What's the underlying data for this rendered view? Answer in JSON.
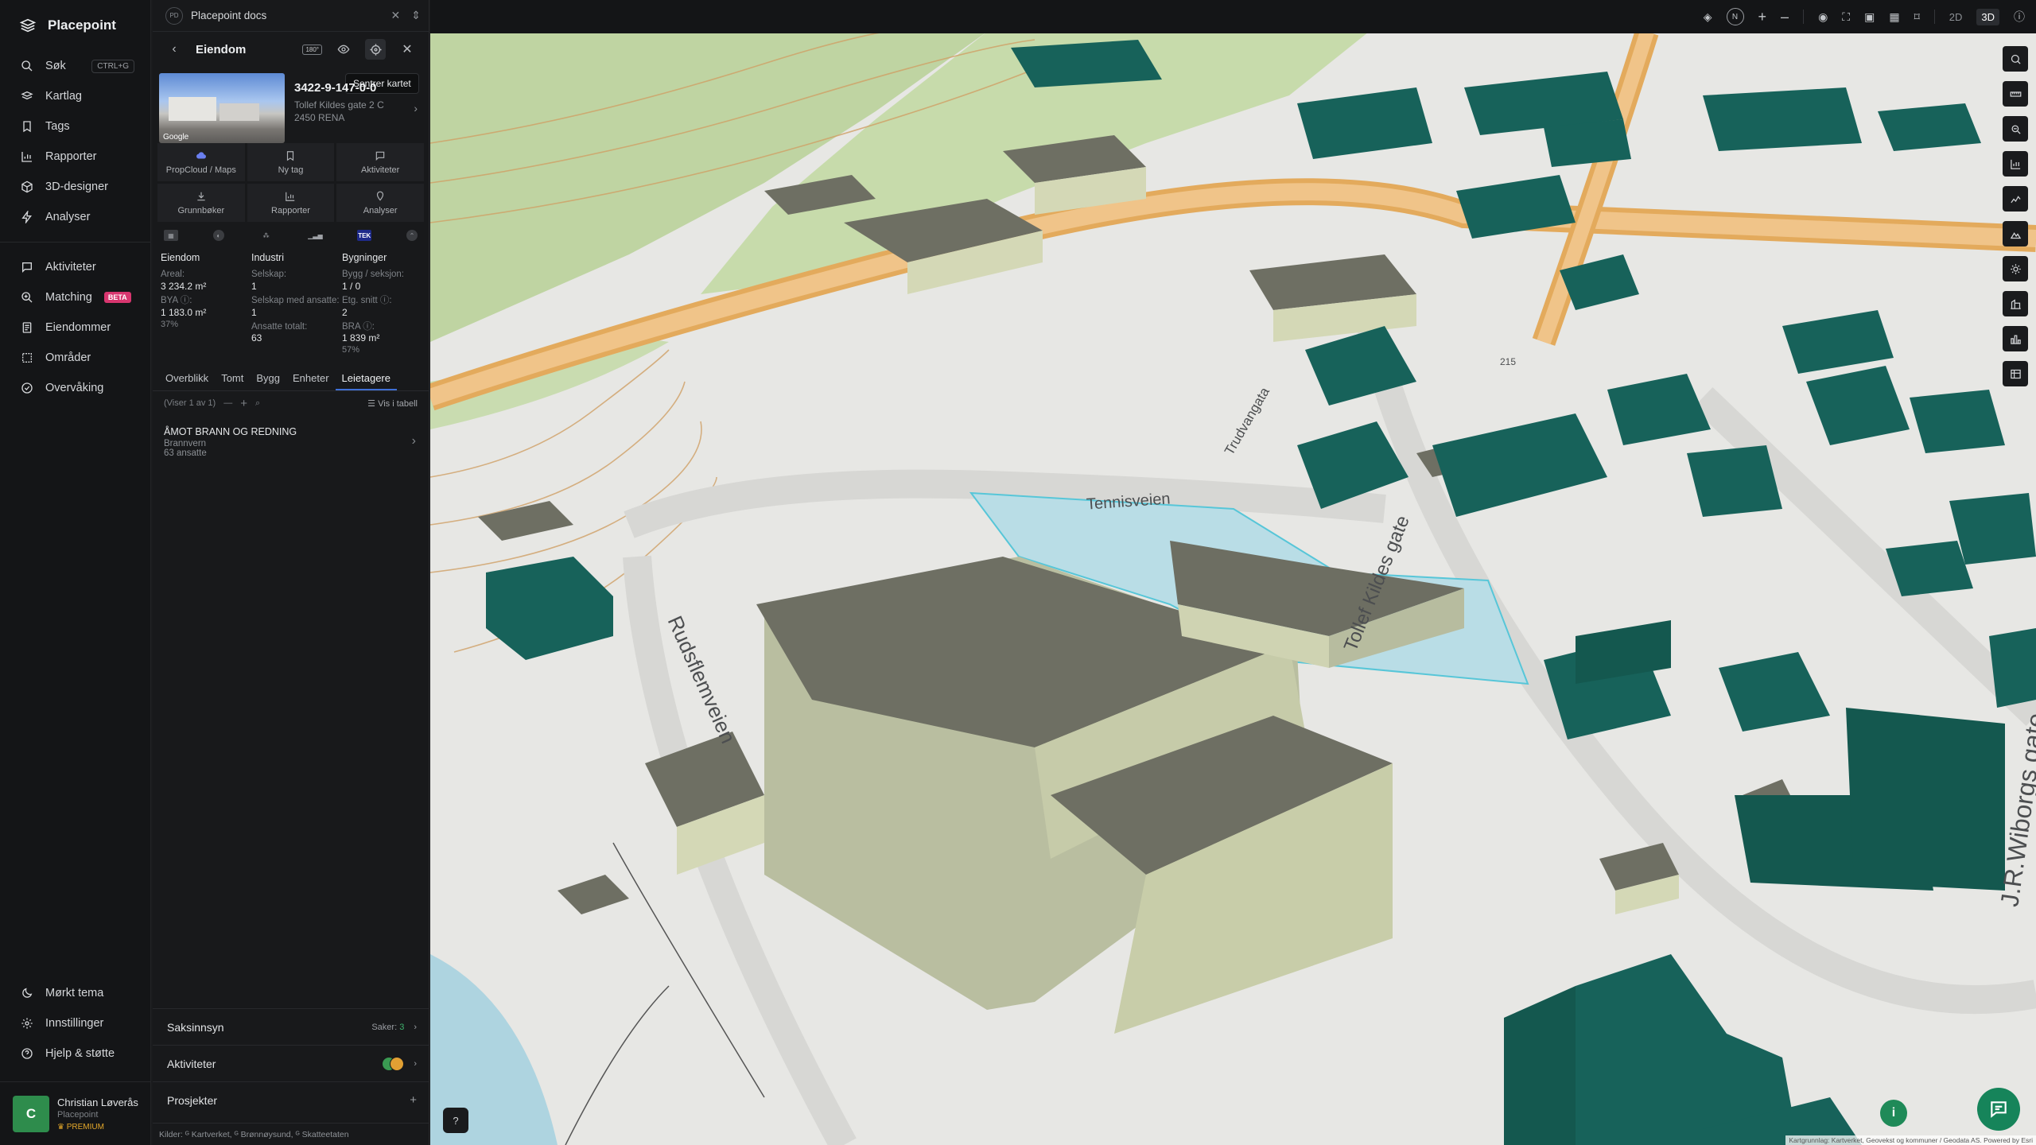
{
  "nav": {
    "brand": "Placepoint",
    "items": [
      {
        "label": "Søk",
        "shortcut": "CTRL+G"
      },
      {
        "label": "Kartlag"
      },
      {
        "label": "Tags"
      },
      {
        "label": "Rapporter"
      },
      {
        "label": "3D-designer"
      },
      {
        "label": "Analyser"
      }
    ],
    "items2": [
      {
        "label": "Aktiviteter"
      },
      {
        "label": "Matching",
        "badge": "BETA"
      },
      {
        "label": "Eiendommer"
      },
      {
        "label": "Områder"
      },
      {
        "label": "Overvåking"
      }
    ],
    "bottom": [
      {
        "label": "Mørkt tema"
      },
      {
        "label": "Innstillinger"
      },
      {
        "label": "Hjelp & støtte"
      }
    ],
    "user": {
      "initial": "C",
      "name": "Christian Løverås",
      "org": "Placepoint",
      "plan": "PREMIUM"
    }
  },
  "panel": {
    "docs_title": "Placepoint docs",
    "docs_badge": "PD",
    "header_title": "Eiendom",
    "pill": "180°",
    "tooltip": "Sentrer kartet",
    "property": {
      "id": "3422-9-147-0-0",
      "address": "Tollef Kildes gate 2 C",
      "zip": "2450 RENA",
      "thumb_credit": "Google"
    },
    "tiles": [
      "PropCloud / Maps",
      "Ny tag",
      "Aktiviteter",
      "Grunnbøker",
      "Rapporter",
      "Analyser"
    ],
    "src_tek": "TEK",
    "stats": {
      "eiendom": {
        "title": "Eiendom",
        "areal_l": "Areal:",
        "areal_v": "3 234.2 m²",
        "bya_l": "BYA ⓘ:",
        "bya_v": "1 183.0 m²",
        "bya_p": "37%"
      },
      "industri": {
        "title": "Industri",
        "selskap_l": "Selskap:",
        "selskap_v": "1",
        "ansatte_l": "Selskap med ansatte:",
        "ansatte_v": "1",
        "total_l": "Ansatte totalt:",
        "total_v": "63"
      },
      "bygninger": {
        "title": "Bygninger",
        "bygg_l": "Bygg / seksjon:",
        "bygg_v": "1 / 0",
        "etg_l": "Etg. snitt ⓘ:",
        "etg_v": "2",
        "bra_l": "BRA ⓘ:",
        "bra_v": "1 839 m²",
        "bra_p": "57%"
      }
    },
    "tabs": [
      "Overblikk",
      "Tomt",
      "Bygg",
      "Enheter",
      "Leietagere"
    ],
    "list_count": "(Viser 1 av 1)",
    "list_table": "Vis i tabell",
    "lease": {
      "name": "ÅMOT BRANN OG REDNING",
      "type": "Brannvern",
      "employees": "63 ansatte"
    },
    "acc": {
      "saksinnsyn": "Saksinnsyn",
      "saker_label": "Saker:",
      "saker_count": "3",
      "aktiviteter": "Aktiviteter",
      "prosjekter": "Prosjekter"
    },
    "sources": "Kilder: ᴳ Kartverket, ᴳ Brønnøysund, ᴳ Skatteetaten"
  },
  "map": {
    "topbar": {
      "mode2d": "2D",
      "mode3d": "3D",
      "compass": "N",
      "plus": "+",
      "minus": "–"
    },
    "labels": {
      "tennisveien": "Tennisveien",
      "tollef": "Tollef Kildes gate",
      "rudsflemveien": "Rudsflemveien",
      "jr": "J.R.Wiborgs gate",
      "trudvang": "Trudvangata",
      "r215": "215"
    },
    "attribution": "Kartgrunnlag: Kartverket, Geovekst og kommuner / Geodata AS. Powered by Esri",
    "help": "?",
    "info": "i"
  }
}
